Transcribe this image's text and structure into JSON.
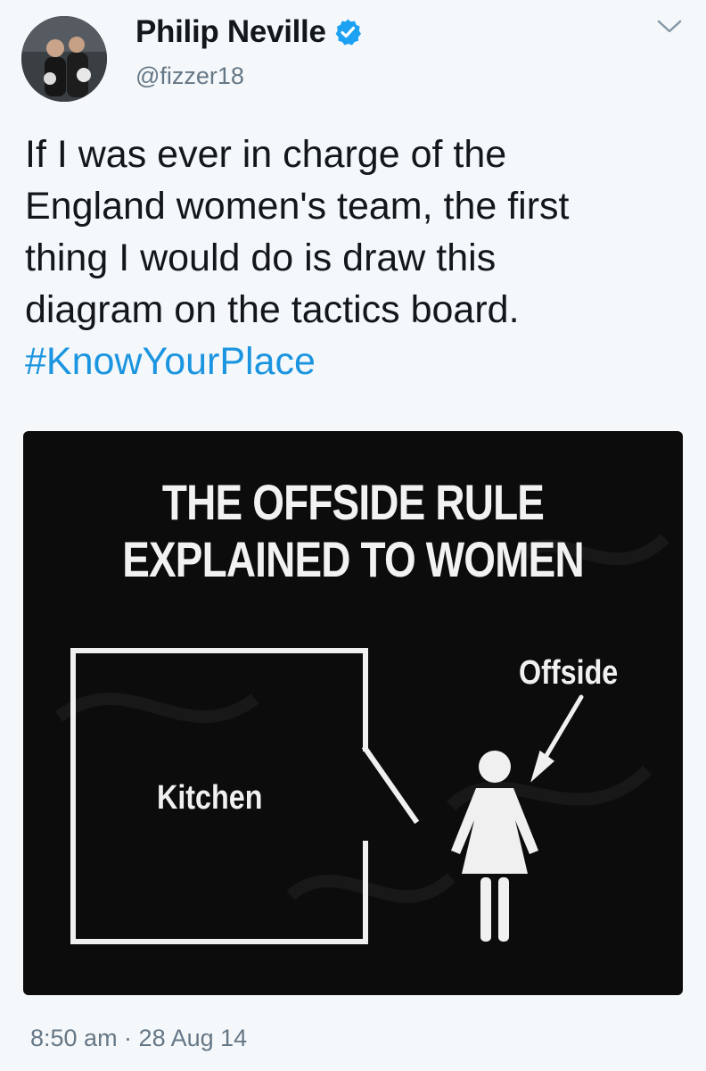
{
  "tweet": {
    "author": {
      "display_name": "Philip Neville",
      "handle": "@fizzer18",
      "verified": true,
      "avatar_icon": "profile-photo"
    },
    "menu_icon": "chevron-down-icon",
    "text_lines": [
      "If I was ever in charge of the",
      "England women's team, the first",
      "thing I would do is draw this",
      "diagram on the tactics board."
    ],
    "hashtag": "#KnowYourPlace",
    "media": {
      "title_lines": [
        "THE OFFSIDE RULE",
        "EXPLAINED TO WOMEN"
      ],
      "kitchen_label": "Kitchen",
      "offside_label": "Offside"
    },
    "timestamp": "8:50 am · 28 Aug 14"
  },
  "colors": {
    "background": "#f5f8fa",
    "text": "#14171a",
    "secondary_text": "#657786",
    "link": "#1b95e0",
    "verified_badge": "#1da1f2",
    "media_background": "#0c0c0c"
  }
}
